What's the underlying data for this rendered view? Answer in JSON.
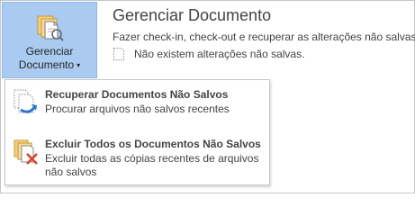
{
  "manage_button": {
    "line1": "Gerenciar",
    "line2": "Documento",
    "caret": "▾"
  },
  "panel": {
    "title": "Gerenciar Documento",
    "description": "Fazer check-in, check-out e recuperar as alterações não salvas.",
    "status": "Não existem alterações não salvas."
  },
  "menu": {
    "items": [
      {
        "title": "Recuperar Documentos Não Salvos",
        "description": "Procurar arquivos não salvos recentes",
        "icon": "recover-documents-icon"
      },
      {
        "title": "Excluir Todos os Documentos Não Salvos",
        "description": "Excluir todas as cópias recentes de arquivos não salvos",
        "icon": "delete-documents-icon"
      }
    ]
  },
  "colors": {
    "button_bg": "#a9cbf1",
    "text": "#444444",
    "icon_gold": "#e8b449",
    "icon_blue": "#2e76c8",
    "icon_red": "#d9412c"
  }
}
